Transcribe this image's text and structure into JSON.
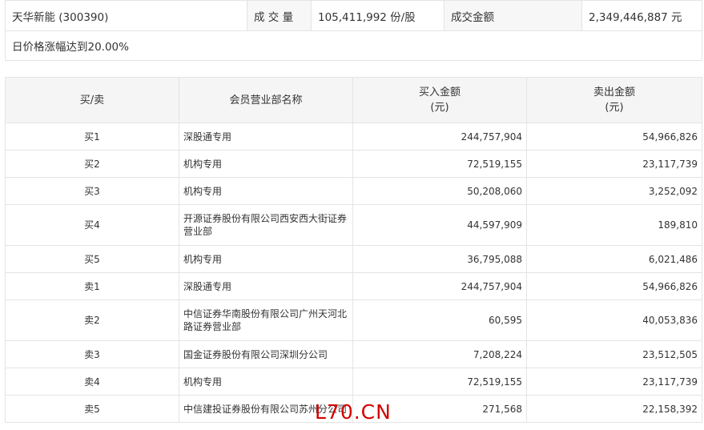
{
  "summary": {
    "stock": "天华新能 (300390)",
    "volume_label": "成 交 量",
    "volume_value": "105,411,992 份/股",
    "amount_label": "成交金额",
    "amount_value": "2,349,446,887 元",
    "note": "日价格涨幅达到20.00%"
  },
  "table": {
    "headers": {
      "side": "买/卖",
      "branch": "会员营业部名称",
      "buy_line1": "买入金额",
      "buy_line2": "(元)",
      "sell_line1": "卖出金额",
      "sell_line2": "(元)"
    },
    "rows": [
      {
        "side": "买1",
        "name": "深股通专用",
        "buy": "244,757,904",
        "sell": "54,966,826"
      },
      {
        "side": "买2",
        "name": "机构专用",
        "buy": "72,519,155",
        "sell": "23,117,739"
      },
      {
        "side": "买3",
        "name": "机构专用",
        "buy": "50,208,060",
        "sell": "3,252,092"
      },
      {
        "side": "买4",
        "name": "开源证券股份有限公司西安西大街证券营业部",
        "buy": "44,597,909",
        "sell": "189,810"
      },
      {
        "side": "买5",
        "name": "机构专用",
        "buy": "36,795,088",
        "sell": "6,021,486"
      },
      {
        "side": "卖1",
        "name": "深股通专用",
        "buy": "244,757,904",
        "sell": "54,966,826"
      },
      {
        "side": "卖2",
        "name": "中信证券华南股份有限公司广州天河北路证券营业部",
        "buy": "60,595",
        "sell": "40,053,836"
      },
      {
        "side": "卖3",
        "name": "国金证券股份有限公司深圳分公司",
        "buy": "7,208,224",
        "sell": "23,512,505"
      },
      {
        "side": "卖4",
        "name": "机构专用",
        "buy": "72,519,155",
        "sell": "23,117,739"
      },
      {
        "side": "卖5",
        "name": "中信建投证券股份有限公司苏州分公司",
        "buy": "271,568",
        "sell": "22,158,392"
      }
    ]
  },
  "watermark": "L70.CN"
}
